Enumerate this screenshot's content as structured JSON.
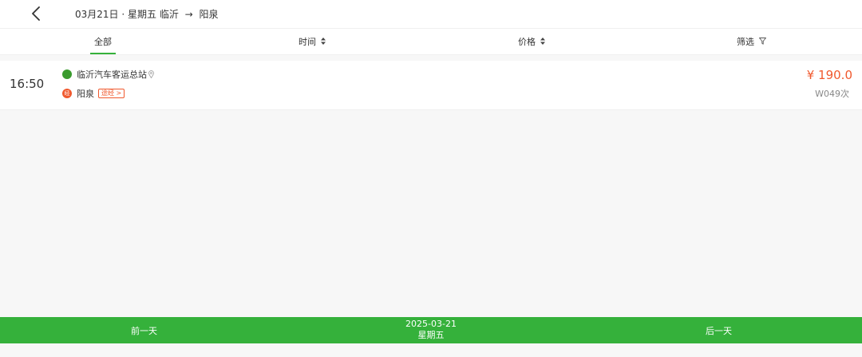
{
  "header": {
    "back_icon": "chevron-left-icon",
    "date_text": "03月21日 · 星期五",
    "origin": "临沂",
    "arrow": "→",
    "destination": "阳泉"
  },
  "tabs": [
    {
      "label": "全部",
      "active": true
    },
    {
      "label": "时间",
      "icon": "sort-icon"
    },
    {
      "label": "价格",
      "icon": "sort-icon"
    },
    {
      "label": "筛选",
      "icon": "filter-icon"
    }
  ],
  "trips": [
    {
      "departure_time": "16:50",
      "start_station": "临沂汽车客运总站",
      "end_mark": "经",
      "end_station": "阳泉",
      "via_label": "途经 >",
      "price": "¥ 190.0",
      "trip_number": "W049次"
    }
  ],
  "bottom_bar": {
    "prev_label": "前一天",
    "current_date": "2025-03-21",
    "current_weekday": "星期五",
    "next_label": "后一天"
  },
  "colors": {
    "accent_green": "#35b13b",
    "price_orange": "#f0592e",
    "start_dot": "#3a9b2e"
  }
}
